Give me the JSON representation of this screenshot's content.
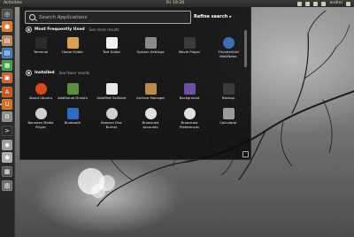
{
  "top_panel": {
    "activities": "Activities",
    "clock": "Fri 19:20",
    "user": "andrei"
  },
  "search": {
    "placeholder": "Search Applications"
  },
  "refine_search": "Refine search",
  "sections": {
    "frequent": {
      "title": "Most Frequently Used",
      "more": "See more results"
    },
    "installed": {
      "title": "Installed",
      "more": "See fewer results"
    }
  },
  "frequent_apps": [
    {
      "label": "Terminal",
      "icon": "terminal-icon",
      "color": "#2b2b2b"
    },
    {
      "label": "Home Folder",
      "icon": "home-folder-icon",
      "color": "#d9a050"
    },
    {
      "label": "Text Editor",
      "icon": "text-editor-icon",
      "color": "#f2f2f2"
    },
    {
      "label": "System Settings",
      "icon": "gear-icon",
      "color": "#8a8a8a"
    },
    {
      "label": "Movie Player",
      "icon": "movie-player-icon",
      "color": "#3a3a3a"
    },
    {
      "label": "Thunderbird Mail/News",
      "icon": "thunderbird-icon",
      "color": "#3d6fb6"
    }
  ],
  "installed_apps": [
    {
      "label": "About Ubuntu",
      "icon": "ubuntu-icon",
      "color": "#dd4814"
    },
    {
      "label": "Additional Drivers",
      "icon": "drivers-icon",
      "color": "#5a8f3c"
    },
    {
      "label": "AisleRiot Solitaire",
      "icon": "cards-icon",
      "color": "#e8e8e8"
    },
    {
      "label": "Archive Manager",
      "icon": "archive-icon",
      "color": "#b98a4a"
    },
    {
      "label": "Background",
      "icon": "background-icon",
      "color": "#6b4fa0"
    },
    {
      "label": "Backup",
      "icon": "backup-icon",
      "color": "#3b3b3b"
    },
    {
      "label": "Banshee Media Player",
      "icon": "banshee-icon",
      "color": "#d0d0d0"
    },
    {
      "label": "Bluetooth",
      "icon": "bluetooth-icon",
      "color": "#2f6cc1"
    },
    {
      "label": "Brasero Disc Burner",
      "icon": "disc-icon",
      "color": "#cfcfcf"
    },
    {
      "label": "Broadcast Accounts",
      "icon": "broadcast-icon",
      "color": "#e0e0e0"
    },
    {
      "label": "Broadcast Preferences",
      "icon": "broadcast-prefs-icon",
      "color": "#e0e0e0"
    },
    {
      "label": "Calculator",
      "icon": "calculator-icon",
      "color": "#9a9a9a"
    }
  ],
  "launcher": [
    {
      "name": "dash-home-icon",
      "color": "#4b4b4b",
      "glyph": "◎"
    },
    {
      "name": "firefox-icon",
      "color": "#e0782b",
      "glyph": "●"
    },
    {
      "name": "files-icon",
      "color": "#b8845a",
      "glyph": "▤"
    },
    {
      "name": "libreoffice-writer-icon",
      "color": "#3d75b8",
      "glyph": "▤"
    },
    {
      "name": "libreoffice-calc-icon",
      "color": "#3b9b3b",
      "glyph": "▦"
    },
    {
      "name": "libreoffice-impress-icon",
      "color": "#c8612f",
      "glyph": "▣"
    },
    {
      "name": "software-center-icon",
      "color": "#c5531f",
      "glyph": "A"
    },
    {
      "name": "ubuntu-one-icon",
      "color": "#d9691c",
      "glyph": "U"
    },
    {
      "name": "system-settings-icon",
      "color": "#8a8a8a",
      "glyph": "⚙"
    },
    {
      "name": "terminal-icon",
      "color": "#2a2a2a",
      "glyph": ">"
    },
    {
      "name": "disk-icon",
      "color": "#999999",
      "glyph": "◉"
    },
    {
      "name": "disk-icon-2",
      "color": "#aaaaaa",
      "glyph": "◉"
    },
    {
      "name": "workspace-switcher-icon",
      "color": "#555555",
      "glyph": "▦"
    },
    {
      "name": "trash-icon",
      "color": "#6a6a6a",
      "glyph": "▥"
    }
  ]
}
